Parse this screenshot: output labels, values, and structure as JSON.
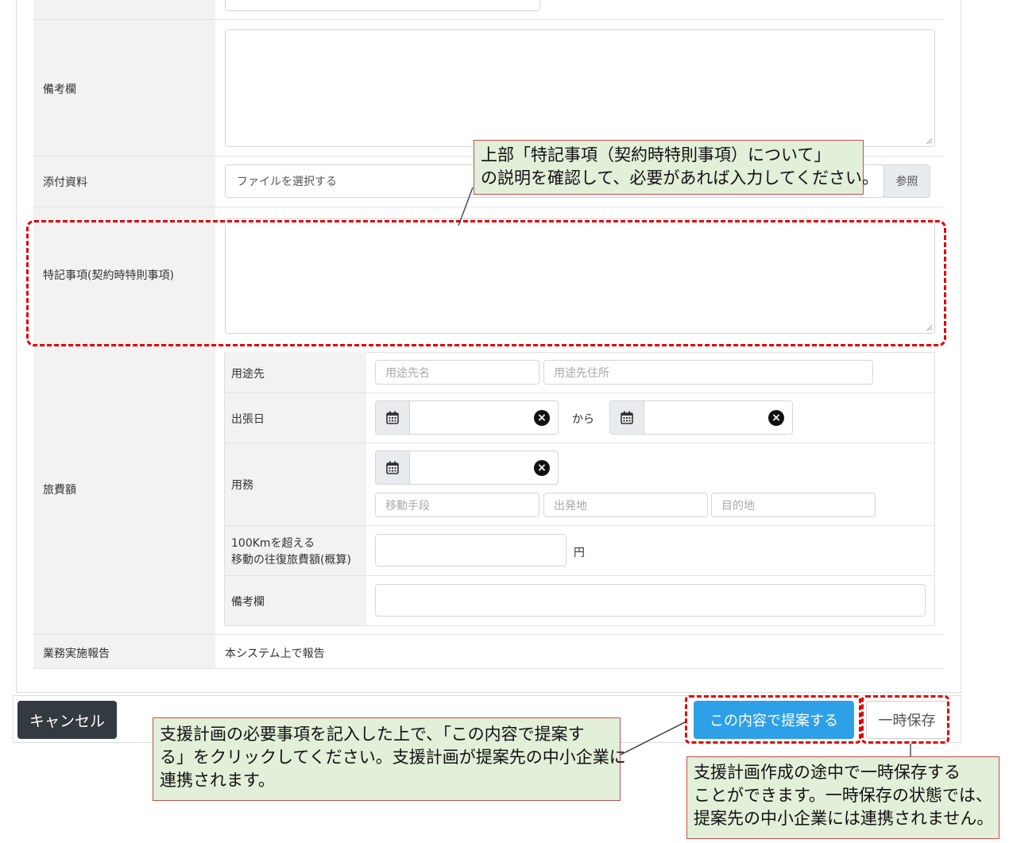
{
  "form": {
    "remarks_label": "備考欄",
    "attachment_label": "添付資料",
    "file_placeholder": "ファイルを選択する",
    "browse_label": "参照",
    "special_label": "特記事項(契約時特則事項)",
    "travel_label": "旅費額",
    "report_label": "業務実施報告",
    "report_value": "本システム上で報告",
    "travel": {
      "destination_label": "用途先",
      "dest_name_placeholder": "用途先名",
      "dest_address_placeholder": "用途先住所",
      "trip_date_label": "出張日",
      "from_label": "から",
      "business_label": "用務",
      "transport_placeholder": "移動手段",
      "departure_placeholder": "出発地",
      "destination_placeholder": "目的地",
      "over100_line1": "100Kmを超える",
      "over100_line2": "移動の往復旅費額(概算)",
      "yen": "円",
      "remarks_label": "備考欄"
    }
  },
  "buttons": {
    "cancel": "キャンセル",
    "propose": "この内容で提案する",
    "save": "一時保存"
  },
  "callouts": {
    "special_line1": "上部「特記事項（契約時特則事項）について」",
    "special_line2": "の説明を確認して、必要があれば入力してください。",
    "propose_line1": "支援計画の必要事項を記入した上で、「この内容で提案す",
    "propose_line2": "る」をクリックしてください。支援計画が提案先の中小企業に",
    "propose_line3": "連携されます。",
    "save_line1": "支援計画作成の途中で一時保存する",
    "save_line2": "ことができます。一時保存の状態では、",
    "save_line3": "提案先の中小企業には連携されません。"
  },
  "colors": {
    "primary": "#2ea0e8",
    "dark": "#333a40",
    "highlight": "#e00000",
    "callout_bg": "#e2efd9"
  }
}
